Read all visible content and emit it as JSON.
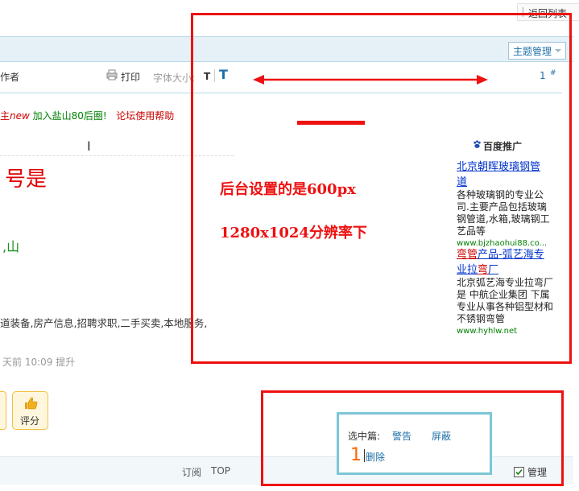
{
  "nav": {
    "return_label": "返回列表"
  },
  "header": {
    "topic_manage_label": "主题管理"
  },
  "toolbar": {
    "author_label": "作者",
    "print_label": "打印",
    "font_size_label": "字体大小:",
    "font_small": "T",
    "font_large": "T",
    "floor_number": "1",
    "floor_symbol": "#"
  },
  "post": {
    "links": [
      {
        "text": "主",
        "style": "red"
      },
      {
        "text": "new",
        "style": "new"
      },
      {
        "text": " 加入盐山80后圈!",
        "style": "green"
      },
      {
        "text": "论坛使用帮助",
        "style": "red"
      }
    ],
    "big_text": "号是",
    "shan_text": ",山",
    "service_text": "道装备,房产信息,招聘求职,二手买卖,本地服务,",
    "time_text": "天前 10:09 提升",
    "rate_label": "评分"
  },
  "ad": {
    "header": "百度推广",
    "items": [
      {
        "title_lines": [
          "北京朝晖玻璃钢管",
          "道"
        ],
        "desc_lines": [
          "各种玻璃钢的专业公",
          "司.主要产品包括玻璃",
          "钢管道,水箱,玻璃钢工",
          "艺品等"
        ],
        "url": "www.bjzhaohui88.co..."
      },
      {
        "title_line1_red": "弯管",
        "title_line1_rest": "产品-弧艺海专",
        "title_line2_rest": "业拉",
        "title_line2_red": "弯",
        "title_line2_end": "厂",
        "desc_lines": [
          "北京弧艺海专业拉弯厂",
          "是 中航企业集团 下属",
          "专业从事各种铝型材和",
          "不锈钢弯管"
        ],
        "url": "www.hyhlw.net"
      }
    ]
  },
  "annotations": {
    "note_line1": "后台设置的是600px",
    "note_line2": "1280x1024分辨率下"
  },
  "mod": {
    "selected_label": "选中篇:",
    "warn_label": "警告",
    "block_label": "屏蔽",
    "count": "1",
    "delete_label": "删除"
  },
  "footer": {
    "subscribe_label": "订阅",
    "top_label": "TOP",
    "manage_label": "管理",
    "manage_checked": true
  },
  "colors": {
    "annotation_red": "#ee1111",
    "link_blue": "#1e6fa8",
    "header_bg": "#e5f1f7",
    "cyan_box": "#7cc6d6"
  }
}
